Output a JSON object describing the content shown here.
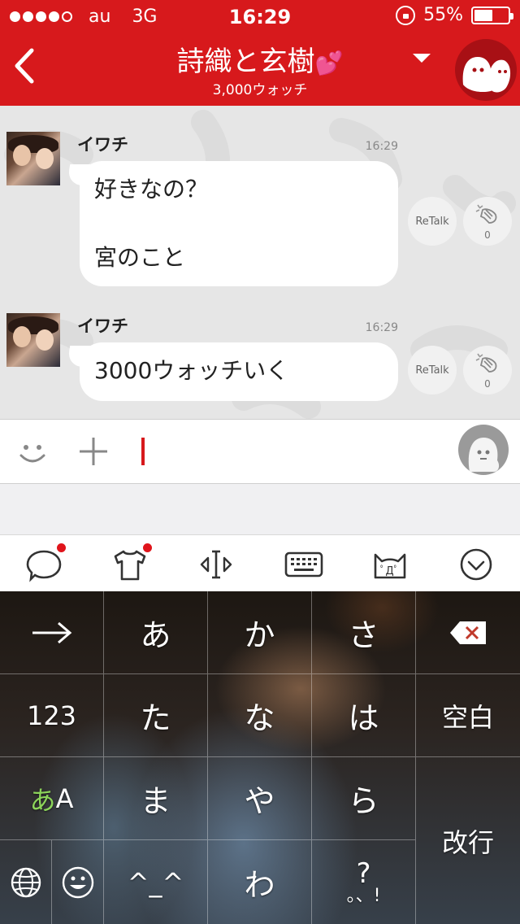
{
  "status_bar": {
    "carrier": "au",
    "network": "3G",
    "time": "16:29",
    "battery_percent": "55%",
    "battery_level": 0.55
  },
  "nav": {
    "title": "詩織と玄樹",
    "watch_count": "3,000ウォッチ"
  },
  "messages": [
    {
      "sender": "イワチ",
      "time": "16:29",
      "lines": [
        "好きなの？",
        "",
        "宮のこと"
      ],
      "retalk_label": "ReTalk",
      "clap_count": "0"
    },
    {
      "sender": "イワチ",
      "time": "16:29",
      "lines": [
        "3000ウォッチいく"
      ],
      "retalk_label": "ReTalk",
      "clap_count": "0"
    }
  ],
  "input": {
    "value": ""
  },
  "keyboard": {
    "row1": [
      "あ",
      "か",
      "さ"
    ],
    "row2": [
      "123",
      "た",
      "な",
      "は",
      "空白"
    ],
    "row3_mode_left": "あ",
    "row3_mode_right": "A",
    "row3": [
      "ま",
      "や",
      "ら"
    ],
    "row4_emoticon": "^_^",
    "row4_wa": "わ",
    "row4_punct_top": "?",
    "row4_punct_bottom": "。、!",
    "enter": "改行"
  },
  "colors": {
    "brand_red": "#d7191c",
    "chat_bg": "#e6e6e6",
    "bubble": "#ffffff",
    "cursor": "#d7191c"
  }
}
